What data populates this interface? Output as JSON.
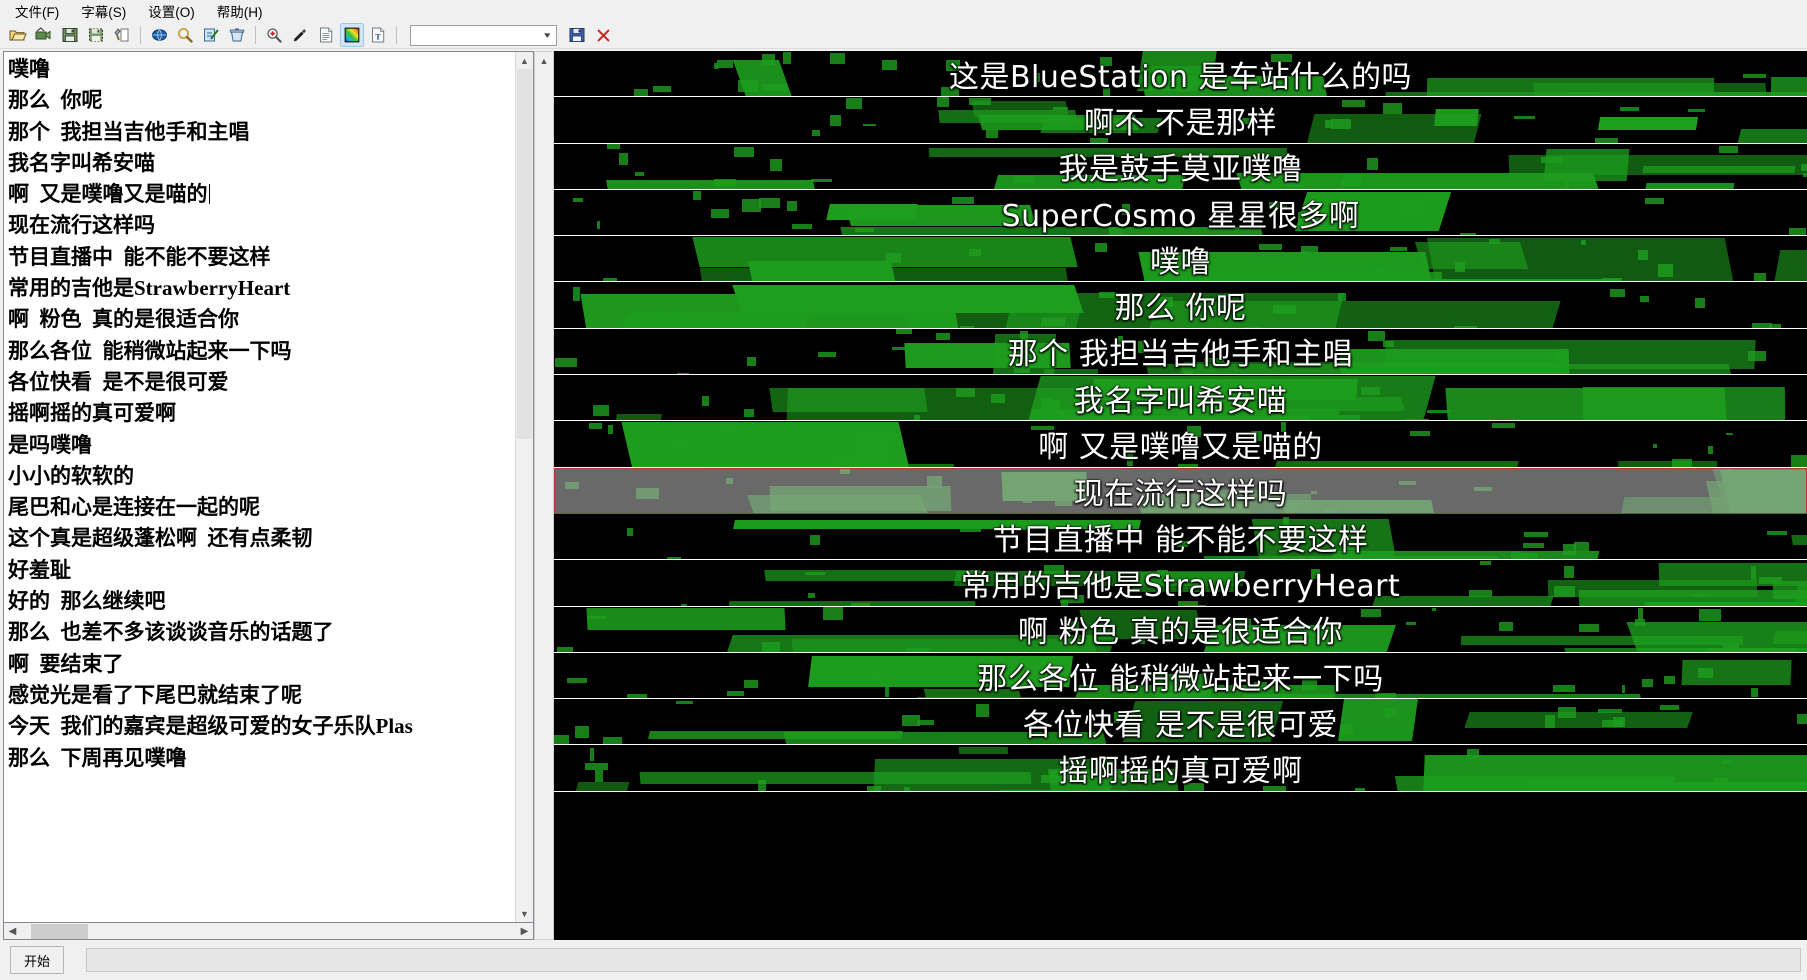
{
  "window": {
    "title": "Subtitle Editor"
  },
  "menubar": {
    "items": [
      {
        "label": "文件(F)",
        "name": "menu-file"
      },
      {
        "label": "字幕(S)",
        "name": "menu-subtitle"
      },
      {
        "label": "设置(O)",
        "name": "menu-settings"
      },
      {
        "label": "帮助(H)",
        "name": "menu-help"
      }
    ]
  },
  "toolbar": {
    "buttons": [
      {
        "icon": "open-folder-icon",
        "title": "打开"
      },
      {
        "icon": "import-video-icon",
        "title": "导入视频"
      },
      {
        "icon": "save-icon",
        "title": "保存"
      },
      {
        "icon": "save-as-icon",
        "title": "另存为"
      },
      {
        "icon": "tools-icon",
        "title": "工具"
      },
      {
        "icon": "translate-icon",
        "title": "翻译"
      },
      {
        "icon": "search-icon",
        "title": "查找"
      },
      {
        "icon": "edit-check-icon",
        "title": "编辑"
      },
      {
        "icon": "trash-icon",
        "title": "删除"
      },
      {
        "icon": "zoom-in-icon",
        "title": "放大"
      },
      {
        "icon": "eyedropper-icon",
        "title": "取色"
      },
      {
        "icon": "document-icon",
        "title": "文档"
      },
      {
        "icon": "palette-icon",
        "title": "调色板"
      },
      {
        "icon": "font-style-icon",
        "title": "字体"
      }
    ],
    "combo_value": "",
    "combo_placeholder": "",
    "save_red_icon": "save-icon-red",
    "close_icon": "close-icon",
    "accent_selected": "#cfe6f7"
  },
  "subtitle_list": {
    "lines": [
      "噗噜",
      "那么  你呢",
      "那个  我担当吉他手和主唱",
      "我名字叫希安喵",
      "啊  又是噗噜又是喵的",
      "现在流行这样吗",
      "节目直播中  能不能不要这样",
      "常用的吉他是StrawberryHeart",
      "啊  粉色  真的是很适合你",
      "那么各位  能稍微站起来一下吗",
      "各位快看  是不是很可爱",
      "摇啊摇的真可爱啊",
      "是吗噗噜",
      "小小的软软的",
      "尾巴和心是连接在一起的呢",
      "这个真是超级蓬松啊  还有点柔韧",
      "好羞耻",
      "好的  那么继续吧",
      "那么  也差不多该谈谈音乐的话题了",
      "啊  要结束了",
      "感觉光是看了下尾巴就结束了呢",
      "今天  我们的嘉宾是超级可爱的女子乐队Plas",
      "那么  下周再见噗噜"
    ],
    "caret_line_index": 4,
    "scroll_left_arrow": "chevron-left-icon",
    "scroll_right_arrow": "chevron-right-icon",
    "scroll_up_arrow": "chevron-up-icon",
    "scroll_down_arrow": "chevron-down-icon"
  },
  "video_rows": {
    "selected_index": 9,
    "selection_border_color": "#b03a3a",
    "rows": [
      {
        "caption": "这是BlueStation 是车站什么的吗"
      },
      {
        "caption": "啊不 不是那样"
      },
      {
        "caption": "我是鼓手莫亚噗噜"
      },
      {
        "caption": "SuperCosmo 星星很多啊"
      },
      {
        "caption": "噗噜"
      },
      {
        "caption": "那么 你呢"
      },
      {
        "caption": "那个 我担当吉他手和主唱"
      },
      {
        "caption": "我名字叫希安喵"
      },
      {
        "caption": "啊 又是噗噜又是喵的"
      },
      {
        "caption": "现在流行这样吗"
      },
      {
        "caption": "节目直播中 能不能不要这样"
      },
      {
        "caption": "常用的吉他是StrawberryHeart"
      },
      {
        "caption": "啊 粉色 真的是很适合你"
      },
      {
        "caption": "那么各位 能稍微站起来一下吗"
      },
      {
        "caption": "各位快看 是不是很可爱"
      },
      {
        "caption": "摇啊摇的真可爱啊"
      }
    ],
    "background_color": "#000000",
    "graphic_color": "#1e9e1e",
    "caption_color": "#ffffff"
  },
  "statusbar": {
    "start_label": "开始",
    "status_text": ""
  }
}
